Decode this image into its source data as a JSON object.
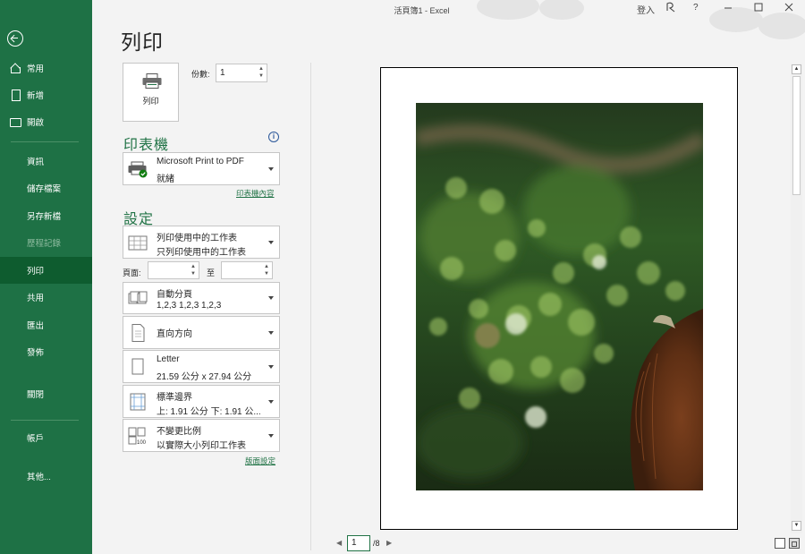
{
  "window": {
    "title": "活頁簿1 - Excel",
    "sign_in": "登入",
    "help": "?"
  },
  "sidebar": {
    "items": [
      {
        "label": "常用",
        "icon": "home-icon"
      },
      {
        "label": "新增",
        "icon": "new-document-icon"
      },
      {
        "label": "開啟",
        "icon": "open-folder-icon"
      },
      {
        "label": "資訊"
      },
      {
        "label": "儲存檔案"
      },
      {
        "label": "另存新檔"
      },
      {
        "label": "歷程記錄"
      },
      {
        "label": "列印"
      },
      {
        "label": "共用"
      },
      {
        "label": "匯出"
      },
      {
        "label": "發佈"
      },
      {
        "label": "關閉"
      },
      {
        "label": "帳戶"
      },
      {
        "label": "其他..."
      }
    ],
    "active_index": 7,
    "disabled_index": 6
  },
  "print": {
    "title": "列印",
    "button_label": "列印",
    "copies_label": "份數:",
    "copies_value": "1"
  },
  "printer": {
    "heading": "印表機",
    "name": "Microsoft Print to PDF",
    "status": "就緒",
    "properties_link": "印表機內容"
  },
  "settings": {
    "heading": "設定",
    "scope": {
      "line1": "列印使用中的工作表",
      "line2": "只列印使用中的工作表"
    },
    "pages_label": "頁面:",
    "pages_to": "至",
    "collation": {
      "line1": "自動分頁",
      "line2": "1,2,3    1,2,3    1,2,3"
    },
    "orientation": {
      "line1": "直向方向"
    },
    "paper": {
      "line1": "Letter",
      "line2": "21.59 公分 x 27.94 公分"
    },
    "margins": {
      "line1": "標準邊界",
      "line2": "上: 1.91 公分 下: 1.91 公..."
    },
    "scaling": {
      "line1": "不變更比例",
      "line2": "以實際大小列印工作表"
    },
    "page_setup_link": "版面設定"
  },
  "preview": {
    "current_page": "1",
    "total_pages": "/8"
  },
  "colors": {
    "accent": "#217346",
    "sidebar": "#1e7145",
    "sidebar_active": "#0e5c2f"
  }
}
